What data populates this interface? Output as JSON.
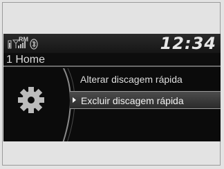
{
  "status": {
    "clock": "12:34",
    "radio_label": "RM",
    "icons": [
      "phone-battery-icon",
      "signal-strength-icon",
      "roaming-label",
      "bluetooth-icon"
    ]
  },
  "header": {
    "title": "1 Home"
  },
  "menu": {
    "items": [
      {
        "label": "Alterar discagem rápida",
        "selected": false
      },
      {
        "label": "Excluir discagem rápida",
        "selected": true
      },
      {
        "label": "",
        "selected": false
      }
    ],
    "side_icon": "gear-icon"
  },
  "colors": {
    "screen_bg": "#0b0b0b",
    "text": "#dedede",
    "highlight": "#4c4c4c",
    "outer_bg": "#e3e3e3"
  }
}
